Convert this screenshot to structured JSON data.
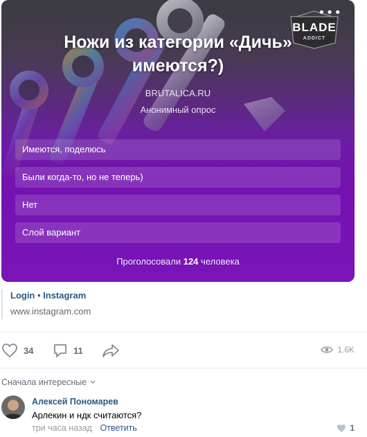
{
  "poll": {
    "brand_logo": {
      "word": "BLADE",
      "sub": "ADDICT"
    },
    "menu_icon": "more-dots-icon",
    "title": "Ножи из категории «Дичь» имеются?)",
    "source": "BRUTALICA.RU",
    "type": "Анонимный опрос",
    "options": [
      {
        "label": "Имеются, поделюсь"
      },
      {
        "label": "Были когда-то, но не теперь)"
      },
      {
        "label": "Нет"
      },
      {
        "label": "Слой вариант"
      }
    ],
    "votes_prefix": "Проголосовали",
    "votes_count": "124",
    "votes_suffix": "человека",
    "colors": {
      "gradient_top": "#3b3a42",
      "gradient_bottom": "#7a14b8"
    }
  },
  "link": {
    "title": "Login • Instagram",
    "url": "www.instagram.com"
  },
  "actions": {
    "likes": {
      "icon": "heart-icon",
      "count": "34"
    },
    "comments": {
      "icon": "comment-icon",
      "count": "11"
    },
    "share": {
      "icon": "share-arrow-icon"
    },
    "views": {
      "icon": "eye-icon",
      "count": "1.6K"
    }
  },
  "comments": {
    "sort_label": "Сначала интересные",
    "items": [
      {
        "author": "Алексей Пономарев",
        "text": "Арлекин и ндк считаются?",
        "time": "три часа назад",
        "reply_label": "Ответить",
        "likes": "1"
      }
    ]
  },
  "accent_color": "#2a5885"
}
